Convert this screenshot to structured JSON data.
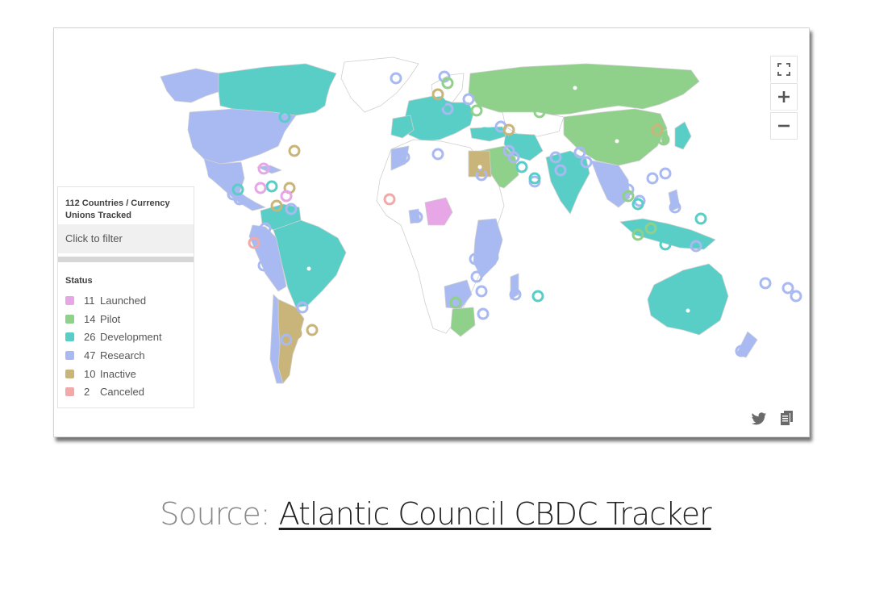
{
  "legend": {
    "title": "112 Countries / Currency Unions Tracked",
    "filter_label": "Click to filter",
    "status_heading": "Status",
    "items": [
      {
        "count": "11",
        "label": "Launched",
        "color": "#e7a6e6"
      },
      {
        "count": "14",
        "label": "Pilot",
        "color": "#8fd08a"
      },
      {
        "count": "26",
        "label": "Development",
        "color": "#58cec7"
      },
      {
        "count": "47",
        "label": "Research",
        "color": "#a9b9f2"
      },
      {
        "count": "10",
        "label": "Inactive",
        "color": "#c9b57a"
      },
      {
        "count": "2",
        "label": "Canceled",
        "color": "#f2a9a9"
      }
    ]
  },
  "controls": {
    "fullscreen_icon": "fullscreen-icon",
    "zoom_in_icon": "plus-icon",
    "zoom_out_icon": "minus-icon",
    "share_icons": [
      "twitter-icon",
      "copy-icon"
    ]
  },
  "colors": {
    "launched": "#e7a6e6",
    "pilot": "#8fd08a",
    "development": "#58cec7",
    "research": "#a9b9f2",
    "inactive": "#c9b57a",
    "canceled": "#f2a9a9",
    "untracked": "#ffffff",
    "border": "#c8c8c8"
  },
  "caption": {
    "prefix": "Source: ",
    "link_text": "Atlantic Council CBDC Tracker"
  }
}
